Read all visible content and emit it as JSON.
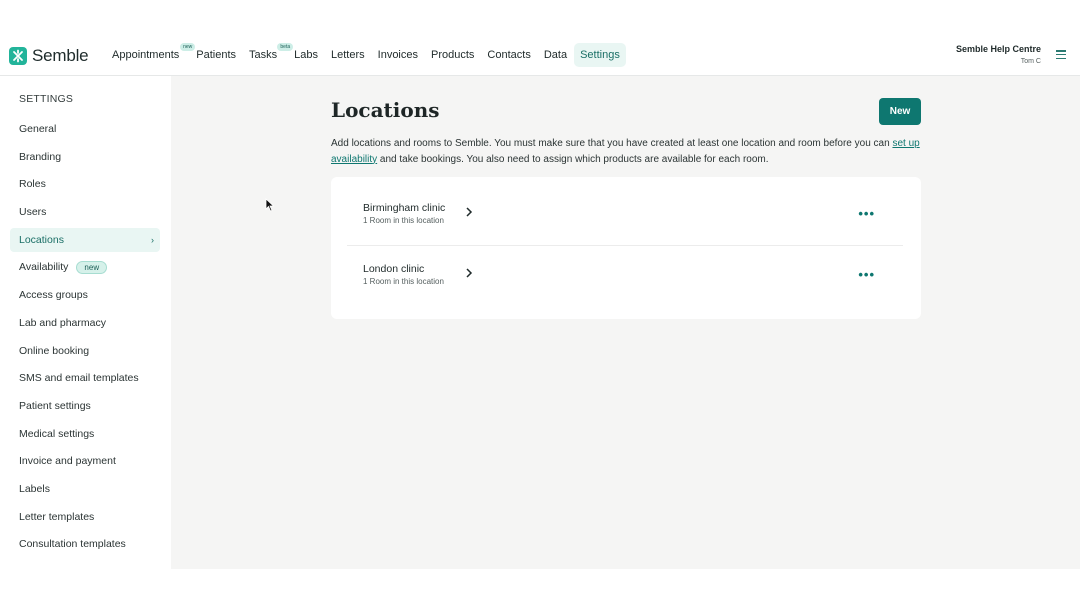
{
  "brand": {
    "name": "Semble",
    "accent": "#22b49a",
    "primary": "#0e7770"
  },
  "nav": {
    "items": [
      {
        "label": "Appointments",
        "badge": "new"
      },
      {
        "label": "Patients",
        "badge": null
      },
      {
        "label": "Tasks",
        "badge": "beta"
      },
      {
        "label": "Labs",
        "badge": null
      },
      {
        "label": "Letters",
        "badge": null
      },
      {
        "label": "Invoices",
        "badge": null
      },
      {
        "label": "Products",
        "badge": null
      },
      {
        "label": "Contacts",
        "badge": null
      },
      {
        "label": "Data",
        "badge": null
      },
      {
        "label": "Settings",
        "badge": null,
        "active": true
      }
    ]
  },
  "help": {
    "title": "Semble Help Centre",
    "user": "Tom C"
  },
  "sidebar": {
    "heading": "SETTINGS",
    "items": [
      {
        "label": "General"
      },
      {
        "label": "Branding"
      },
      {
        "label": "Roles"
      },
      {
        "label": "Users"
      },
      {
        "label": "Locations",
        "active": true,
        "chevron": "›"
      },
      {
        "label": "Availability",
        "pill": "new"
      },
      {
        "label": "Access groups"
      },
      {
        "label": "Lab and pharmacy"
      },
      {
        "label": "Online booking"
      },
      {
        "label": "SMS and email templates"
      },
      {
        "label": "Patient settings"
      },
      {
        "label": "Medical settings"
      },
      {
        "label": "Invoice and payment"
      },
      {
        "label": "Labels"
      },
      {
        "label": "Letter templates"
      },
      {
        "label": "Consultation templates"
      }
    ]
  },
  "main": {
    "title": "Locations",
    "new_button": "New",
    "description_pre": "Add locations and rooms to Semble. You must make sure that you have created at least one location and room before you can ",
    "description_link": "set up availability",
    "description_post": " and take bookings. You also need to assign which products are available for each room.",
    "locations": [
      {
        "name": "Birmingham clinic",
        "rooms": "1 Room in this location"
      },
      {
        "name": "London clinic",
        "rooms": "1 Room in this location"
      }
    ],
    "more_icon": "more-horizontal-icon"
  }
}
